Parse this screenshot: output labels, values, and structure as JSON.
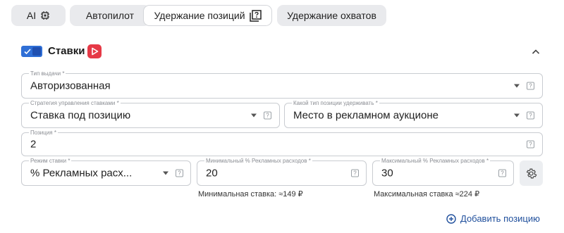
{
  "tabs": [
    {
      "label": "AI",
      "icon": "chip-icon"
    },
    {
      "label": "Автопилот"
    },
    {
      "label": "Удержание позиций",
      "icon": "help-square-icon"
    },
    {
      "label": "Удержание охватов"
    }
  ],
  "section": {
    "title": "Ставки",
    "enabled": true,
    "badge_color": "#e63946"
  },
  "fields": {
    "issue_type": {
      "label": "Тип выдачи *",
      "value": "Авторизованная"
    },
    "strategy": {
      "label": "Стратегия управления ставками *",
      "value": "Ставка под позицию"
    },
    "position_type": {
      "label": "Какой тип позиции удерживать *",
      "value": "Место в рекламном аукционе"
    },
    "position": {
      "label": "Позиция *",
      "value": "2"
    },
    "bid_mode": {
      "label": "Режим ставки *",
      "value": "% Рекламных расх..."
    },
    "min_pct": {
      "label": "Минимальный % Рекламных расходов *",
      "value": "20"
    },
    "max_pct": {
      "label": "Максимальный % Рекламных расходов *",
      "value": "30"
    }
  },
  "hints": {
    "min_bid": "Минимальная ставка: ≈149 ₽",
    "max_bid": "Максимальная ставка ≈224 ₽"
  },
  "add_position": "Добавить позицию",
  "question_mark": "?",
  "colors": {
    "accent": "#2f6fd6",
    "link": "#1f4f9c",
    "border": "#c9ccd1"
  }
}
